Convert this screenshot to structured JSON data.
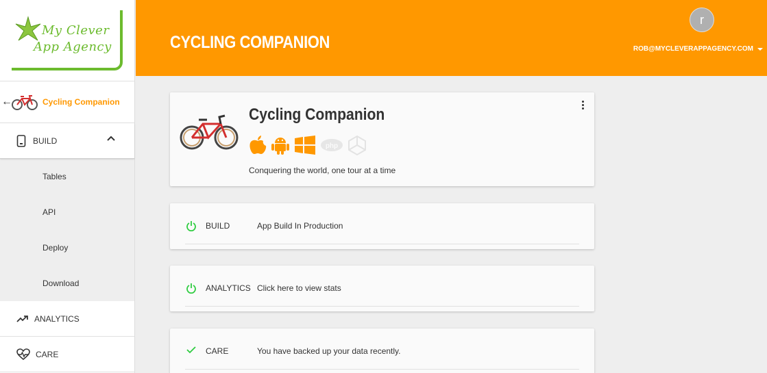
{
  "logo": {
    "line1": "My Clever",
    "line2": "App Agency"
  },
  "sidebar": {
    "app_name": "Cycling Companion",
    "build_label": "BUILD",
    "sub_items": [
      "Tables",
      "API",
      "Deploy",
      "Download"
    ],
    "analytics_label": "ANALYTICS",
    "care_label": "CARE"
  },
  "header": {
    "title": "CYCLING COMPANION",
    "avatar_letter": "r",
    "user_email": "ROB@MYCLEVERAPPAGENCY.COM"
  },
  "app_card": {
    "title": "Cycling Companion",
    "tagline": "Conquering the world, one tour at a time",
    "platform_icons": [
      "apple-icon",
      "android-icon",
      "windows-icon",
      "php-icon",
      "unity-icon"
    ]
  },
  "status": [
    {
      "key": "BUILD",
      "value": "App Build In Production",
      "icon": "power-icon"
    },
    {
      "key": "ANALYTICS",
      "value": "Click here to view stats",
      "icon": "power-icon"
    },
    {
      "key": "CARE",
      "value": "You have backed up your data recently.",
      "icon": "check-icon"
    }
  ],
  "colors": {
    "accent": "#ff9800",
    "brand_green": "#6cbb2e",
    "status_green": "#2ecc40"
  }
}
